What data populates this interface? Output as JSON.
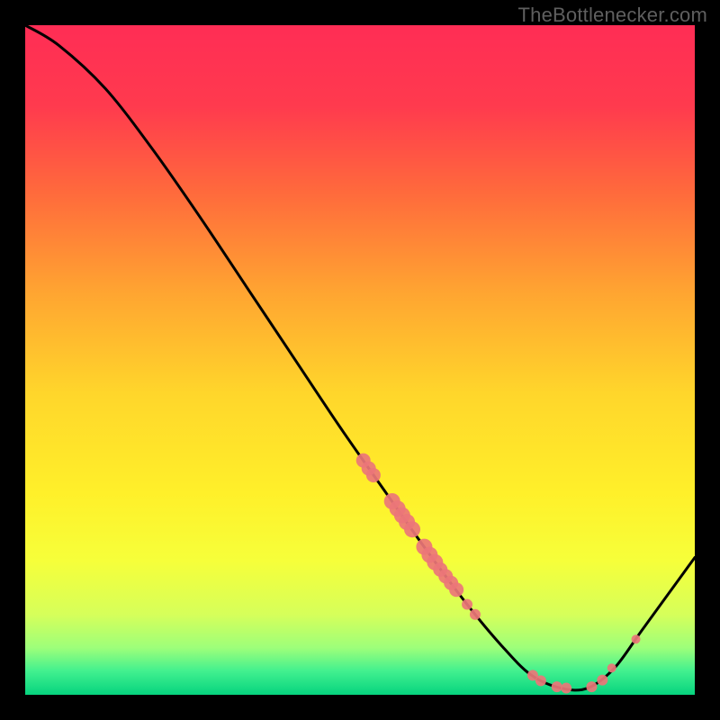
{
  "watermark": "TheBottlenecker.com",
  "chart_data": {
    "type": "line",
    "title": "",
    "xlabel": "",
    "ylabel": "",
    "xlim": [
      0,
      1
    ],
    "ylim": [
      0,
      1
    ],
    "gradient_stops": [
      {
        "offset": 0.0,
        "color": "#ff2d55"
      },
      {
        "offset": 0.12,
        "color": "#ff3a4e"
      },
      {
        "offset": 0.25,
        "color": "#ff6a3c"
      },
      {
        "offset": 0.4,
        "color": "#ffa531"
      },
      {
        "offset": 0.55,
        "color": "#ffd62b"
      },
      {
        "offset": 0.7,
        "color": "#fff02a"
      },
      {
        "offset": 0.8,
        "color": "#f6ff3a"
      },
      {
        "offset": 0.88,
        "color": "#d6ff5a"
      },
      {
        "offset": 0.93,
        "color": "#9dff7a"
      },
      {
        "offset": 0.965,
        "color": "#41f08f"
      },
      {
        "offset": 1.0,
        "color": "#06d37e"
      }
    ],
    "curve": [
      {
        "x": 0.0,
        "y": 1.0
      },
      {
        "x": 0.05,
        "y": 0.97
      },
      {
        "x": 0.12,
        "y": 0.905
      },
      {
        "x": 0.19,
        "y": 0.815
      },
      {
        "x": 0.26,
        "y": 0.715
      },
      {
        "x": 0.33,
        "y": 0.61
      },
      {
        "x": 0.4,
        "y": 0.505
      },
      {
        "x": 0.47,
        "y": 0.4
      },
      {
        "x": 0.54,
        "y": 0.3
      },
      {
        "x": 0.6,
        "y": 0.215
      },
      {
        "x": 0.66,
        "y": 0.135
      },
      {
        "x": 0.71,
        "y": 0.075
      },
      {
        "x": 0.755,
        "y": 0.03
      },
      {
        "x": 0.8,
        "y": 0.01
      },
      {
        "x": 0.84,
        "y": 0.01
      },
      {
        "x": 0.88,
        "y": 0.04
      },
      {
        "x": 0.92,
        "y": 0.095
      },
      {
        "x": 0.96,
        "y": 0.15
      },
      {
        "x": 1.0,
        "y": 0.205
      }
    ],
    "scatter": [
      {
        "x": 0.505,
        "y": 0.35,
        "r": 8
      },
      {
        "x": 0.513,
        "y": 0.338,
        "r": 8
      },
      {
        "x": 0.52,
        "y": 0.328,
        "r": 8
      },
      {
        "x": 0.548,
        "y": 0.289,
        "r": 9
      },
      {
        "x": 0.556,
        "y": 0.278,
        "r": 9
      },
      {
        "x": 0.563,
        "y": 0.268,
        "r": 9
      },
      {
        "x": 0.57,
        "y": 0.258,
        "r": 9
      },
      {
        "x": 0.578,
        "y": 0.247,
        "r": 9
      },
      {
        "x": 0.596,
        "y": 0.221,
        "r": 9
      },
      {
        "x": 0.604,
        "y": 0.209,
        "r": 9
      },
      {
        "x": 0.612,
        "y": 0.198,
        "r": 9
      },
      {
        "x": 0.62,
        "y": 0.187,
        "r": 8
      },
      {
        "x": 0.628,
        "y": 0.177,
        "r": 8
      },
      {
        "x": 0.636,
        "y": 0.167,
        "r": 8
      },
      {
        "x": 0.644,
        "y": 0.157,
        "r": 8
      },
      {
        "x": 0.66,
        "y": 0.135,
        "r": 6
      },
      {
        "x": 0.672,
        "y": 0.12,
        "r": 6
      },
      {
        "x": 0.758,
        "y": 0.029,
        "r": 6
      },
      {
        "x": 0.77,
        "y": 0.021,
        "r": 6
      },
      {
        "x": 0.794,
        "y": 0.012,
        "r": 6
      },
      {
        "x": 0.808,
        "y": 0.01,
        "r": 6
      },
      {
        "x": 0.846,
        "y": 0.012,
        "r": 6
      },
      {
        "x": 0.862,
        "y": 0.022,
        "r": 6
      },
      {
        "x": 0.876,
        "y": 0.04,
        "r": 5
      },
      {
        "x": 0.912,
        "y": 0.083,
        "r": 5
      }
    ],
    "scatter_color": "#eb7678",
    "curve_color": "#000000",
    "curve_width": 3
  }
}
